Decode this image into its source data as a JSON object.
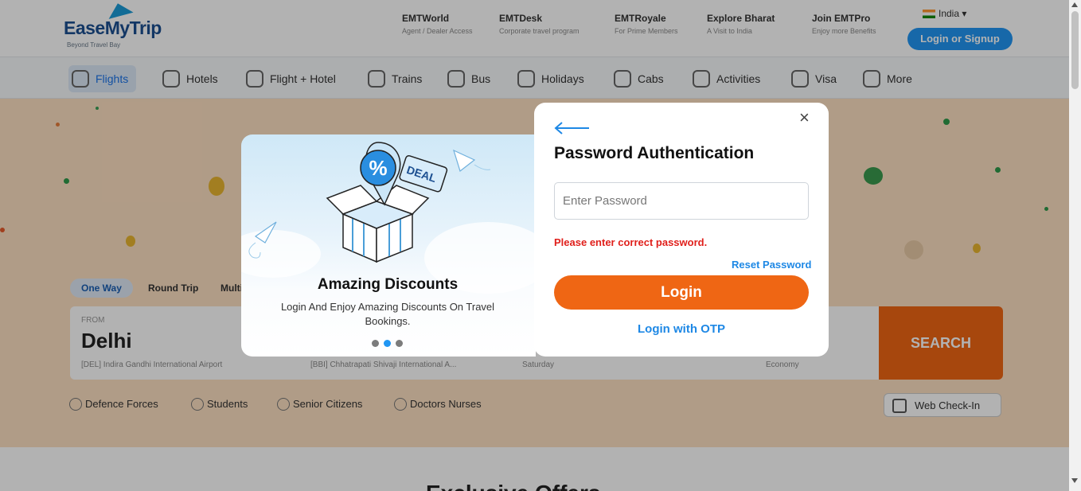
{
  "header": {
    "logo_text": "EaseMyTrip",
    "logo_tagline": "Beyond Travel Bay",
    "topnav": [
      {
        "title": "EMTWorld",
        "sub": "Agent / Dealer Access"
      },
      {
        "title": "EMTDesk",
        "sub": "Corporate travel program"
      },
      {
        "title": "EMTRoyale",
        "sub": "For Prime Members"
      },
      {
        "title": "Explore Bharat",
        "sub": "A Visit to India"
      },
      {
        "title": "Join EMTPro",
        "sub": "Enjoy more Benefits"
      }
    ],
    "country": "India",
    "signin_label": "Login or Signup"
  },
  "mainnav": [
    {
      "label": "Flights",
      "icon": "plane-icon"
    },
    {
      "label": "Hotels",
      "icon": "hotel-icon"
    },
    {
      "label": "Flight + Hotel",
      "icon": "flight-hotel-icon"
    },
    {
      "label": "Trains",
      "icon": "train-icon"
    },
    {
      "label": "Bus",
      "icon": "bus-icon"
    },
    {
      "label": "Holidays",
      "icon": "holidays-icon"
    },
    {
      "label": "Cabs",
      "icon": "cab-icon"
    },
    {
      "label": "Activities",
      "icon": "balloon-icon"
    },
    {
      "label": "Visa",
      "icon": "visa-icon"
    },
    {
      "label": "More",
      "icon": "more-icon"
    }
  ],
  "trip_types": [
    "One Way",
    "Round Trip",
    "Multicity"
  ],
  "search": {
    "from_label": "FROM",
    "from_city": "Delhi",
    "from_airport": "[DEL] Indira Gandhi International Airport",
    "to_airport": "[BBI] Chhatrapati Shivaji International A...",
    "day": "Saturday",
    "class": "Economy",
    "search_label": "SEARCH"
  },
  "special_fares": [
    "Defence Forces",
    "Students",
    "Senior Citizens",
    "Doctors Nurses"
  ],
  "web_checkin": "Web Check-In",
  "lower_title": "Exclusive Offers",
  "promo": {
    "title": "Amazing Discounts",
    "description": "Login And Enjoy Amazing Discounts On Travel Bookings.",
    "deal_tag": "DEAL",
    "percent": "%",
    "slide_count": 3,
    "active_slide": 2
  },
  "auth": {
    "title": "Password Authentication",
    "password_placeholder": "Enter Password",
    "password_value": "",
    "error": "Please enter correct password.",
    "reset_label": "Reset Password",
    "login_label": "Login",
    "otp_label": "Login with OTP",
    "close_glyph": "×"
  },
  "colors": {
    "primary_orange": "#ef6614",
    "link_blue": "#1e88e5",
    "error_red": "#e0201c",
    "hero_bg": "#fde0c2"
  }
}
